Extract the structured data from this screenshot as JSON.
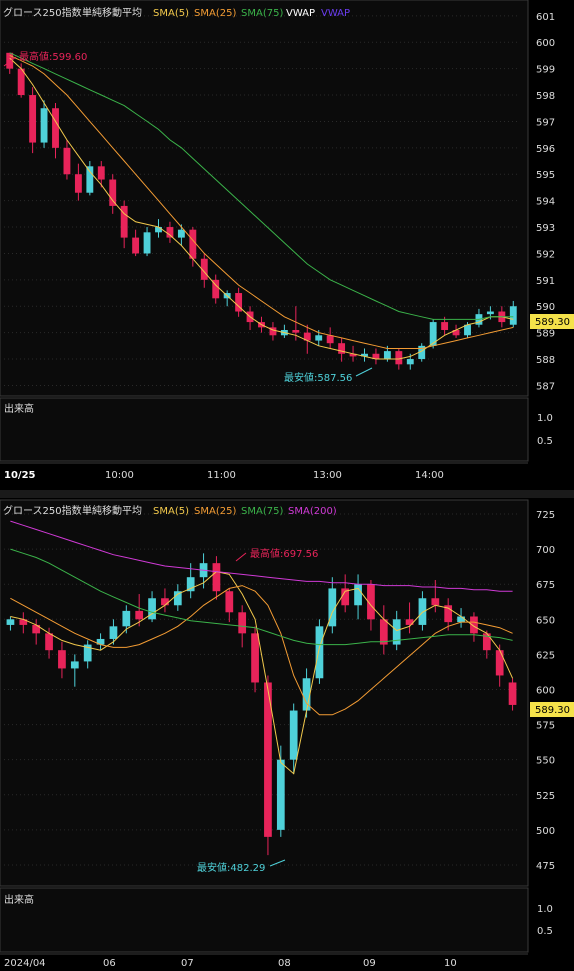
{
  "colors": {
    "background": "#0b0b0b",
    "grid": "#2a2a2a",
    "up": "#4fd1d9",
    "down": "#e8245a",
    "sma5": "#f2c94c",
    "sma25": "#f39c34",
    "sma75": "#3bb34a",
    "sma200": "#d03ad6",
    "vwap": "#ffffff",
    "vwap2": "#6b3df0",
    "last_price_bg": "#f5e24a",
    "last_price_fg": "#000000"
  },
  "intraday": {
    "legend": {
      "title": "グロース250指数",
      "label": "単純移動平均",
      "items": [
        "SMA(5)",
        "SMA(25)",
        "SMA(75)",
        "VWAP",
        "VWAP"
      ]
    },
    "y_ticks": [
      "601",
      "600",
      "599",
      "598",
      "597",
      "596",
      "595",
      "594",
      "593",
      "592",
      "591",
      "590",
      "589",
      "588",
      "587"
    ],
    "last_price": "589.30",
    "high_label": "最高値:599.60",
    "low_label": "最安値:587.56",
    "volume_label": "出来高",
    "volume_ticks": [
      "1.0",
      "0.5"
    ],
    "x_ticks": [
      "10/25",
      "10:00",
      "11:00",
      "13:00",
      "14:00"
    ]
  },
  "daily": {
    "legend": {
      "title": "グロース250指数",
      "label": "単純移動平均",
      "items": [
        "SMA(5)",
        "SMA(25)",
        "SMA(75)",
        "SMA(200)"
      ]
    },
    "y_ticks": [
      "725",
      "700",
      "675",
      "650",
      "625",
      "600",
      "575",
      "550",
      "525",
      "500",
      "475"
    ],
    "last_price": "589.30",
    "high_label": "最高値:697.56",
    "low_label": "最安値:482.29",
    "volume_label": "出来高",
    "volume_ticks": [
      "1.0",
      "0.5"
    ],
    "x_ticks": [
      "2024/04",
      "06",
      "07",
      "08",
      "09",
      "10"
    ]
  },
  "chart_data": [
    {
      "type": "candlestick",
      "title": "グロース250指数",
      "timeframe": "intraday",
      "ylim": [
        586.6,
        601.6
      ],
      "series": [
        {
          "name": "SMA(5)",
          "values": [
            599.4,
            599.0,
            598.4,
            597.7,
            597.0,
            596.3,
            595.7,
            595.1,
            594.6,
            594.0,
            593.5,
            593.2,
            593.1,
            593.0,
            592.7,
            592.3,
            591.8,
            591.3,
            590.8,
            590.4,
            590.0,
            589.6,
            589.3,
            589.1,
            589.0,
            588.9,
            588.7,
            588.5,
            588.4,
            588.3,
            588.2,
            588.1,
            588.0,
            588.0,
            588.0,
            588.1,
            588.3,
            588.6,
            588.9,
            589.1,
            589.3,
            589.4,
            589.6,
            589.6,
            589.5
          ]
        },
        {
          "name": "SMA(25)",
          "values": [
            599.5,
            599.3,
            599.1,
            598.8,
            598.4,
            598.0,
            597.5,
            597.0,
            596.5,
            596.0,
            595.5,
            595.0,
            594.5,
            594.0,
            593.5,
            593.0,
            592.5,
            592.0,
            591.6,
            591.2,
            590.8,
            590.5,
            590.2,
            589.9,
            589.6,
            589.4,
            589.2,
            589.0,
            588.9,
            588.8,
            588.7,
            588.6,
            588.5,
            588.4,
            588.4,
            588.4,
            588.4,
            588.5,
            588.6,
            588.7,
            588.8,
            588.9,
            589.0,
            589.1,
            589.2
          ]
        },
        {
          "name": "SMA(75)",
          "values": [
            599.6,
            599.4,
            599.2,
            599.0,
            598.8,
            598.6,
            598.4,
            598.2,
            598.0,
            597.8,
            597.6,
            597.3,
            597.0,
            596.7,
            596.3,
            596.0,
            595.6,
            595.2,
            594.8,
            594.4,
            594.0,
            593.6,
            593.2,
            592.8,
            592.4,
            592.0,
            591.6,
            591.3,
            591.0,
            590.8,
            590.6,
            590.4,
            590.2,
            590.0,
            589.8,
            589.7,
            589.6,
            589.5,
            589.5,
            589.5,
            589.5,
            589.5,
            589.6,
            589.6,
            589.6
          ]
        }
      ],
      "candles": [
        {
          "o": 599.6,
          "h": 599.6,
          "c": 599.0,
          "l": 598.8
        },
        {
          "o": 599.0,
          "h": 599.2,
          "c": 598.0,
          "l": 597.9
        },
        {
          "o": 598.0,
          "h": 598.3,
          "c": 596.2,
          "l": 595.8
        },
        {
          "o": 596.2,
          "h": 597.8,
          "c": 597.5,
          "l": 596.0
        },
        {
          "o": 597.5,
          "h": 597.7,
          "c": 596.0,
          "l": 595.6
        },
        {
          "o": 596.0,
          "h": 596.3,
          "c": 595.0,
          "l": 594.8
        },
        {
          "o": 595.0,
          "h": 595.4,
          "c": 594.3,
          "l": 594.0
        },
        {
          "o": 594.3,
          "h": 595.5,
          "c": 595.3,
          "l": 594.2
        },
        {
          "o": 595.3,
          "h": 595.5,
          "c": 594.8,
          "l": 594.5
        },
        {
          "o": 594.8,
          "h": 595.0,
          "c": 593.8,
          "l": 593.5
        },
        {
          "o": 593.8,
          "h": 594.0,
          "c": 592.6,
          "l": 592.2
        },
        {
          "o": 592.6,
          "h": 592.9,
          "c": 592.0,
          "l": 591.9
        },
        {
          "o": 592.0,
          "h": 593.0,
          "c": 592.8,
          "l": 591.9
        },
        {
          "o": 592.8,
          "h": 593.3,
          "c": 593.0,
          "l": 592.6
        },
        {
          "o": 593.0,
          "h": 593.2,
          "c": 592.6,
          "l": 592.4
        },
        {
          "o": 592.6,
          "h": 593.1,
          "c": 592.9,
          "l": 592.3
        },
        {
          "o": 592.9,
          "h": 593.0,
          "c": 591.8,
          "l": 591.5
        },
        {
          "o": 591.8,
          "h": 592.0,
          "c": 591.0,
          "l": 590.7
        },
        {
          "o": 591.0,
          "h": 591.2,
          "c": 590.3,
          "l": 590.1
        },
        {
          "o": 590.3,
          "h": 590.6,
          "c": 590.5,
          "l": 590.0
        },
        {
          "o": 590.5,
          "h": 590.7,
          "c": 589.8,
          "l": 589.6
        },
        {
          "o": 589.8,
          "h": 590.0,
          "c": 589.4,
          "l": 589.1
        },
        {
          "o": 589.4,
          "h": 589.6,
          "c": 589.2,
          "l": 589.0
        },
        {
          "o": 589.2,
          "h": 589.4,
          "c": 588.9,
          "l": 588.7
        },
        {
          "o": 588.9,
          "h": 589.3,
          "c": 589.1,
          "l": 588.8
        },
        {
          "o": 589.1,
          "h": 590.0,
          "c": 589.0,
          "l": 588.7
        },
        {
          "o": 589.0,
          "h": 589.3,
          "c": 588.7,
          "l": 588.2
        },
        {
          "o": 588.7,
          "h": 589.1,
          "c": 588.9,
          "l": 588.5
        },
        {
          "o": 588.9,
          "h": 589.2,
          "c": 588.6,
          "l": 588.4
        },
        {
          "o": 588.6,
          "h": 588.8,
          "c": 588.2,
          "l": 587.9
        },
        {
          "o": 588.2,
          "h": 588.5,
          "c": 588.1,
          "l": 587.9
        },
        {
          "o": 588.1,
          "h": 588.4,
          "c": 588.2,
          "l": 587.9
        },
        {
          "o": 588.2,
          "h": 588.4,
          "c": 588.0,
          "l": 587.8
        },
        {
          "o": 588.0,
          "h": 588.5,
          "c": 588.3,
          "l": 587.9
        },
        {
          "o": 588.3,
          "h": 588.4,
          "c": 587.8,
          "l": 587.6
        },
        {
          "o": 587.8,
          "h": 588.2,
          "c": 588.0,
          "l": 587.6
        },
        {
          "o": 588.0,
          "h": 588.6,
          "c": 588.5,
          "l": 587.9
        },
        {
          "o": 588.5,
          "h": 589.5,
          "c": 589.4,
          "l": 588.4
        },
        {
          "o": 589.4,
          "h": 589.6,
          "c": 589.1,
          "l": 588.9
        },
        {
          "o": 589.1,
          "h": 589.3,
          "c": 588.9,
          "l": 588.8
        },
        {
          "o": 588.9,
          "h": 589.4,
          "c": 589.3,
          "l": 588.8
        },
        {
          "o": 589.3,
          "h": 589.9,
          "c": 589.7,
          "l": 589.2
        },
        {
          "o": 589.7,
          "h": 590.0,
          "c": 589.8,
          "l": 589.5
        },
        {
          "o": 589.8,
          "h": 590.0,
          "c": 589.4,
          "l": 589.2
        },
        {
          "o": 589.3,
          "h": 590.2,
          "c": 590.0,
          "l": 589.2
        }
      ]
    },
    {
      "type": "candlestick",
      "title": "グロース250指数",
      "timeframe": "daily",
      "ylim": [
        460,
        735
      ],
      "series": [
        {
          "name": "SMA(5)",
          "values": [
            652,
            650,
            646,
            640,
            635,
            632,
            630,
            628,
            634,
            643,
            648,
            654,
            660,
            668,
            672,
            676,
            684,
            682,
            668,
            650,
            600,
            548,
            540,
            585,
            630,
            655,
            670,
            672,
            660,
            650,
            642,
            645,
            655,
            660,
            658,
            652,
            645,
            640,
            628,
            608
          ]
        },
        {
          "name": "SMA(25)",
          "values": [
            665,
            660,
            655,
            650,
            645,
            640,
            636,
            632,
            630,
            630,
            632,
            636,
            640,
            645,
            652,
            660,
            666,
            672,
            674,
            670,
            660,
            640,
            610,
            590,
            582,
            582,
            586,
            592,
            600,
            608,
            616,
            624,
            632,
            640,
            645,
            648,
            648,
            646,
            644,
            640
          ]
        },
        {
          "name": "SMA(75)",
          "values": [
            700,
            697,
            694,
            690,
            685,
            680,
            675,
            670,
            666,
            662,
            658,
            655,
            653,
            651,
            649,
            648,
            647,
            646,
            645,
            644,
            641,
            638,
            635,
            633,
            632,
            632,
            632,
            633,
            634,
            634,
            635,
            636,
            637,
            638,
            639,
            639,
            639,
            638,
            637,
            635
          ]
        },
        {
          "name": "SMA(200)",
          "values": [
            720,
            717,
            714,
            711,
            708,
            705,
            702,
            699,
            696,
            694,
            692,
            690,
            688,
            687,
            686,
            685,
            684,
            683,
            682,
            681,
            680,
            679,
            678,
            677,
            677,
            676,
            676,
            675,
            675,
            674,
            674,
            674,
            673,
            673,
            672,
            672,
            671,
            671,
            670,
            670
          ]
        }
      ],
      "candles": [
        {
          "o": 646,
          "h": 652,
          "c": 650,
          "l": 642
        },
        {
          "o": 650,
          "h": 655,
          "c": 646,
          "l": 640
        },
        {
          "o": 646,
          "h": 650,
          "c": 640,
          "l": 632
        },
        {
          "o": 640,
          "h": 644,
          "c": 628,
          "l": 622
        },
        {
          "o": 628,
          "h": 634,
          "c": 615,
          "l": 608
        },
        {
          "o": 615,
          "h": 625,
          "c": 620,
          "l": 602
        },
        {
          "o": 620,
          "h": 635,
          "c": 632,
          "l": 615
        },
        {
          "o": 632,
          "h": 640,
          "c": 636,
          "l": 628
        },
        {
          "o": 636,
          "h": 650,
          "c": 645,
          "l": 632
        },
        {
          "o": 645,
          "h": 660,
          "c": 656,
          "l": 640
        },
        {
          "o": 656,
          "h": 668,
          "c": 650,
          "l": 645
        },
        {
          "o": 650,
          "h": 670,
          "c": 665,
          "l": 648
        },
        {
          "o": 665,
          "h": 672,
          "c": 660,
          "l": 655
        },
        {
          "o": 660,
          "h": 675,
          "c": 670,
          "l": 656
        },
        {
          "o": 670,
          "h": 690,
          "c": 680,
          "l": 665
        },
        {
          "o": 680,
          "h": 697,
          "c": 690,
          "l": 672
        },
        {
          "o": 690,
          "h": 695,
          "c": 670,
          "l": 664
        },
        {
          "o": 670,
          "h": 672,
          "c": 655,
          "l": 648
        },
        {
          "o": 655,
          "h": 660,
          "c": 640,
          "l": 630
        },
        {
          "o": 640,
          "h": 645,
          "c": 605,
          "l": 598
        },
        {
          "o": 605,
          "h": 610,
          "c": 495,
          "l": 482
        },
        {
          "o": 500,
          "h": 560,
          "c": 550,
          "l": 495
        },
        {
          "o": 550,
          "h": 590,
          "c": 585,
          "l": 540
        },
        {
          "o": 585,
          "h": 615,
          "c": 608,
          "l": 580
        },
        {
          "o": 608,
          "h": 650,
          "c": 645,
          "l": 604
        },
        {
          "o": 645,
          "h": 680,
          "c": 672,
          "l": 640
        },
        {
          "o": 672,
          "h": 682,
          "c": 660,
          "l": 655
        },
        {
          "o": 660,
          "h": 682,
          "c": 675,
          "l": 650
        },
        {
          "o": 675,
          "h": 678,
          "c": 650,
          "l": 642
        },
        {
          "o": 650,
          "h": 660,
          "c": 632,
          "l": 625
        },
        {
          "o": 632,
          "h": 656,
          "c": 650,
          "l": 628
        },
        {
          "o": 650,
          "h": 662,
          "c": 646,
          "l": 640
        },
        {
          "o": 646,
          "h": 670,
          "c": 665,
          "l": 642
        },
        {
          "o": 665,
          "h": 678,
          "c": 660,
          "l": 655
        },
        {
          "o": 660,
          "h": 665,
          "c": 648,
          "l": 642
        },
        {
          "o": 648,
          "h": 658,
          "c": 652,
          "l": 644
        },
        {
          "o": 652,
          "h": 655,
          "c": 640,
          "l": 634
        },
        {
          "o": 640,
          "h": 642,
          "c": 628,
          "l": 622
        },
        {
          "o": 628,
          "h": 632,
          "c": 610,
          "l": 602
        },
        {
          "o": 605,
          "h": 608,
          "c": 589,
          "l": 585
        }
      ]
    }
  ]
}
